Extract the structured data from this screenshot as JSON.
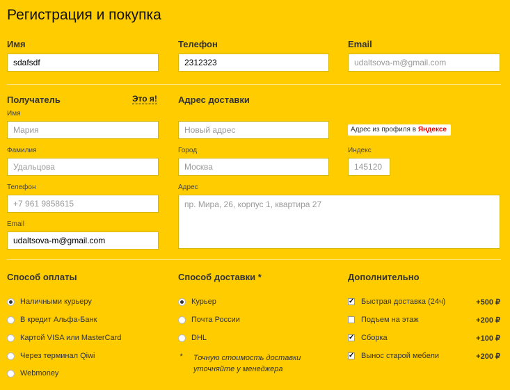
{
  "page_title": "Регистрация и покупка",
  "contact": {
    "name_label": "Имя",
    "name_value": "sdafsdf",
    "phone_label": "Телефон",
    "phone_value": "2312323",
    "email_label": "Email",
    "email_placeholder": "udaltsova-m@gmail.com"
  },
  "recipient": {
    "heading": "Получатель",
    "its_me_link": "Это я!",
    "first_name_label": "Имя",
    "first_name_placeholder": "Мария",
    "last_name_label": "Фамилия",
    "last_name_placeholder": "Удальцова",
    "phone_label": "Телефон",
    "phone_placeholder": "+7 961 9858615",
    "email_label": "Email",
    "email_value": "udaltsova-m@gmail.com"
  },
  "delivery_address": {
    "heading": "Адрес доставки",
    "new_address_placeholder": "Новый адрес",
    "profile_button_text": "Адрес из профиля в ",
    "profile_button_brand": "Яндексе",
    "city_label": "Город",
    "city_placeholder": "Москва",
    "index_label": "Индекс",
    "index_placeholder": "145120",
    "address_label": "Адрес",
    "address_placeholder": "пр. Мира, 26, корпус 1, квартира 27"
  },
  "payment": {
    "heading": "Способ оплаты",
    "options": [
      "Наличными курьеру",
      "В кредит Альфа-Банк",
      "Картой VISA или MasterCard",
      "Через терминал Qiwi",
      "Webmoney"
    ],
    "selected_index": 0
  },
  "shipping": {
    "heading": "Способ доставки *",
    "options": [
      "Курьер",
      "Почта России",
      "DHL"
    ],
    "selected_index": 0,
    "note_mark": "*",
    "note": "Точную стоимость доставки уточняйте у менеджера"
  },
  "extras": {
    "heading": "Дополнительно",
    "items": [
      {
        "label": "Быстрая доставка (24ч)",
        "price": "+500 ₽",
        "checked": true
      },
      {
        "label": "Подъем на этаж",
        "price": "+200 ₽",
        "checked": false
      },
      {
        "label": "Сборка",
        "price": "+100 ₽",
        "checked": true
      },
      {
        "label": "Вынос старой мебели",
        "price": "+200 ₽",
        "checked": true
      }
    ]
  }
}
